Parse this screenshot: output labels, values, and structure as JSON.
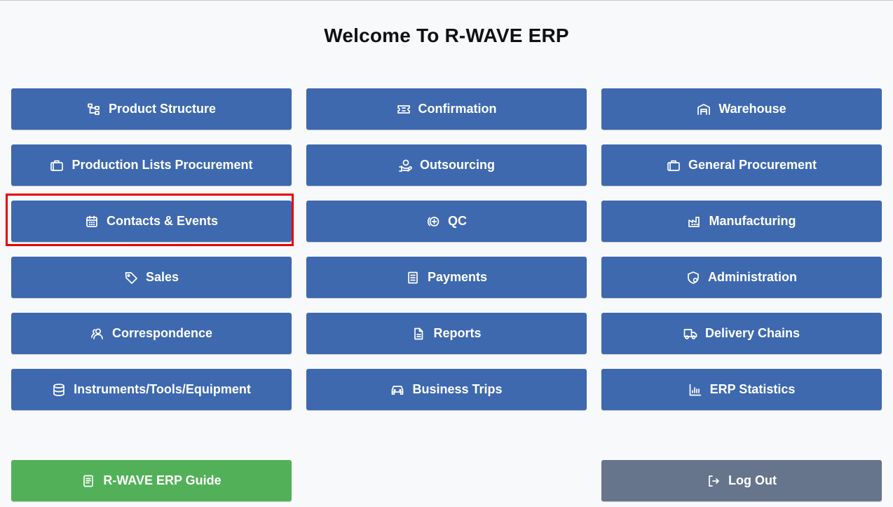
{
  "page": {
    "title": "Welcome To R-WAVE ERP"
  },
  "modules": [
    {
      "label": "Product Structure",
      "icon": "hierarchy-icon"
    },
    {
      "label": "Confirmation",
      "icon": "ticket-icon"
    },
    {
      "label": "Warehouse",
      "icon": "warehouse-icon"
    },
    {
      "label": "Production Lists Procurement",
      "icon": "briefcase-icon"
    },
    {
      "label": "Outsourcing",
      "icon": "hand-coin-icon"
    },
    {
      "label": "General Procurement",
      "icon": "briefcase-icon"
    },
    {
      "label": "Contacts & Events",
      "icon": "calendar-icon"
    },
    {
      "label": "QC",
      "icon": "quality-control-icon"
    },
    {
      "label": "Manufacturing",
      "icon": "factory-icon"
    },
    {
      "label": "Sales",
      "icon": "tag-icon"
    },
    {
      "label": "Payments",
      "icon": "receipt-icon"
    },
    {
      "label": "Administration",
      "icon": "shield-icon"
    },
    {
      "label": "Correspondence",
      "icon": "users-icon"
    },
    {
      "label": "Reports",
      "icon": "document-icon"
    },
    {
      "label": "Delivery Chains",
      "icon": "truck-icon"
    },
    {
      "label": "Instruments/Tools/Equipment",
      "icon": "database-icon"
    },
    {
      "label": "Business Trips",
      "icon": "car-icon"
    },
    {
      "label": "ERP Statistics",
      "icon": "bar-chart-icon"
    }
  ],
  "footer": {
    "guide_label": "R-WAVE ERP Guide",
    "guide_icon": "book-icon",
    "logout_label": "Log Out",
    "logout_icon": "logout-icon"
  },
  "colors": {
    "module_button": "#3e69af",
    "guide_button": "#52b158",
    "logout_button": "#66758c",
    "highlight_border": "#e60000",
    "background": "#f8f9fa"
  }
}
